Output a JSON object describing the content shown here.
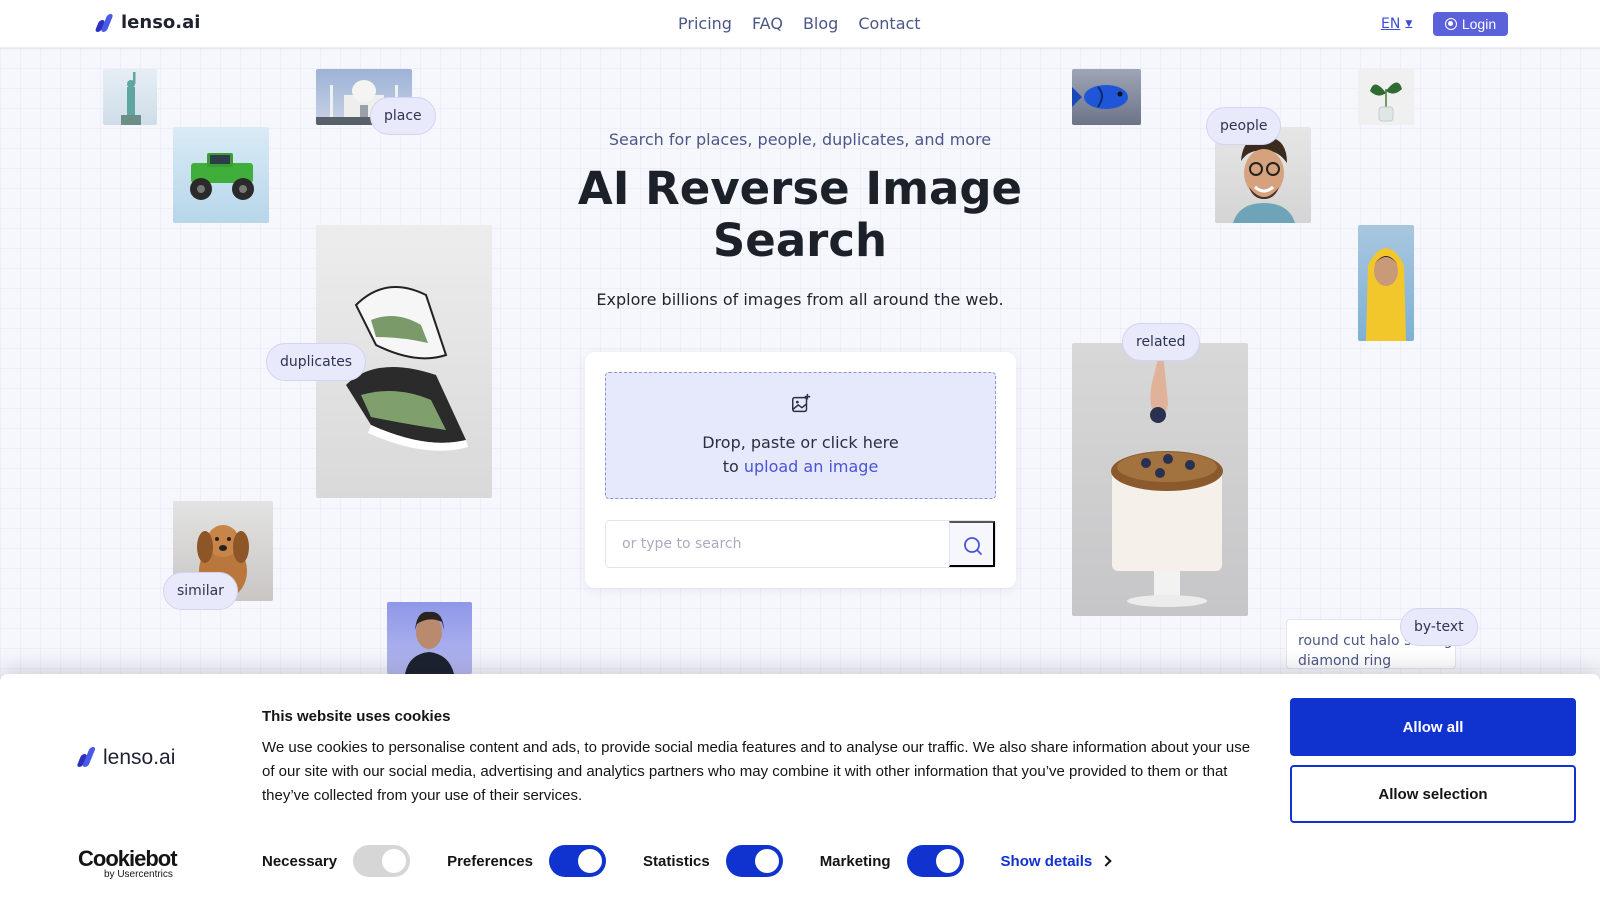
{
  "header": {
    "brand": "lenso.ai",
    "nav": [
      "Pricing",
      "FAQ",
      "Blog",
      "Contact"
    ],
    "language": "EN",
    "login_label": "Login",
    "accent": "#5b60db"
  },
  "hero": {
    "eyebrow": "Search for places, people, duplicates, and more",
    "title": "AI Reverse Image Search",
    "subtitle": "Explore billions of images from all around the web.",
    "dropzone_line1": "Drop, paste or click here",
    "dropzone_line2_prefix": "to",
    "dropzone_link": "upload an image",
    "search_placeholder": "or type to search"
  },
  "tags": {
    "place": "place",
    "duplicates": "duplicates",
    "similar": "similar",
    "people": "people",
    "related": "related",
    "by_text": "by-text",
    "by_text_example": "round cut halo setting diamond ring"
  },
  "images": [
    "statue-of-liberty",
    "taj-mahal",
    "green-monster-truck",
    "sneakers",
    "dog",
    "woman-portrait",
    "blue-fish",
    "plant-in-vase",
    "smiling-man",
    "person-yellow-hood",
    "cake-with-blueberries"
  ],
  "cookie_banner": {
    "brand": "lenso.ai",
    "provider": "Cookiebot",
    "provider_sub": "by Usercentrics",
    "title": "This website uses cookies",
    "text": "We use cookies to personalise content and ads, to provide social media features and to analyse our traffic. We also share information about your use of our site with our social media, advertising and analytics partners who may combine it with other information that you’ve provided to them or that they’ve collected from your use of their services.",
    "consents": [
      {
        "label": "Necessary",
        "on": true,
        "disabled": true
      },
      {
        "label": "Preferences",
        "on": true
      },
      {
        "label": "Statistics",
        "on": true
      },
      {
        "label": "Marketing",
        "on": true
      }
    ],
    "show_details": "Show details",
    "allow_all": "Allow all",
    "allow_selection": "Allow selection",
    "accent": "#1032cf"
  }
}
